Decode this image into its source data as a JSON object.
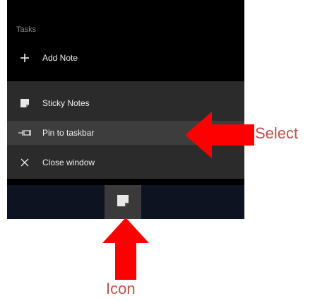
{
  "jumplist": {
    "section_header": "Tasks",
    "add_note": {
      "label": "Add Note",
      "icon": "plus-icon"
    },
    "items": [
      {
        "label": "Sticky Notes",
        "icon": "sticky-notes-icon"
      },
      {
        "label": "Pin to taskbar",
        "icon": "pin-icon"
      },
      {
        "label": "Close window",
        "icon": "close-icon"
      }
    ]
  },
  "taskbar": {
    "app_icon": "sticky-notes-icon"
  },
  "annotations": {
    "select_label": "Select",
    "icon_label": "Icon",
    "arrow_color": "#ff0000",
    "label_color": "#c0504d"
  }
}
